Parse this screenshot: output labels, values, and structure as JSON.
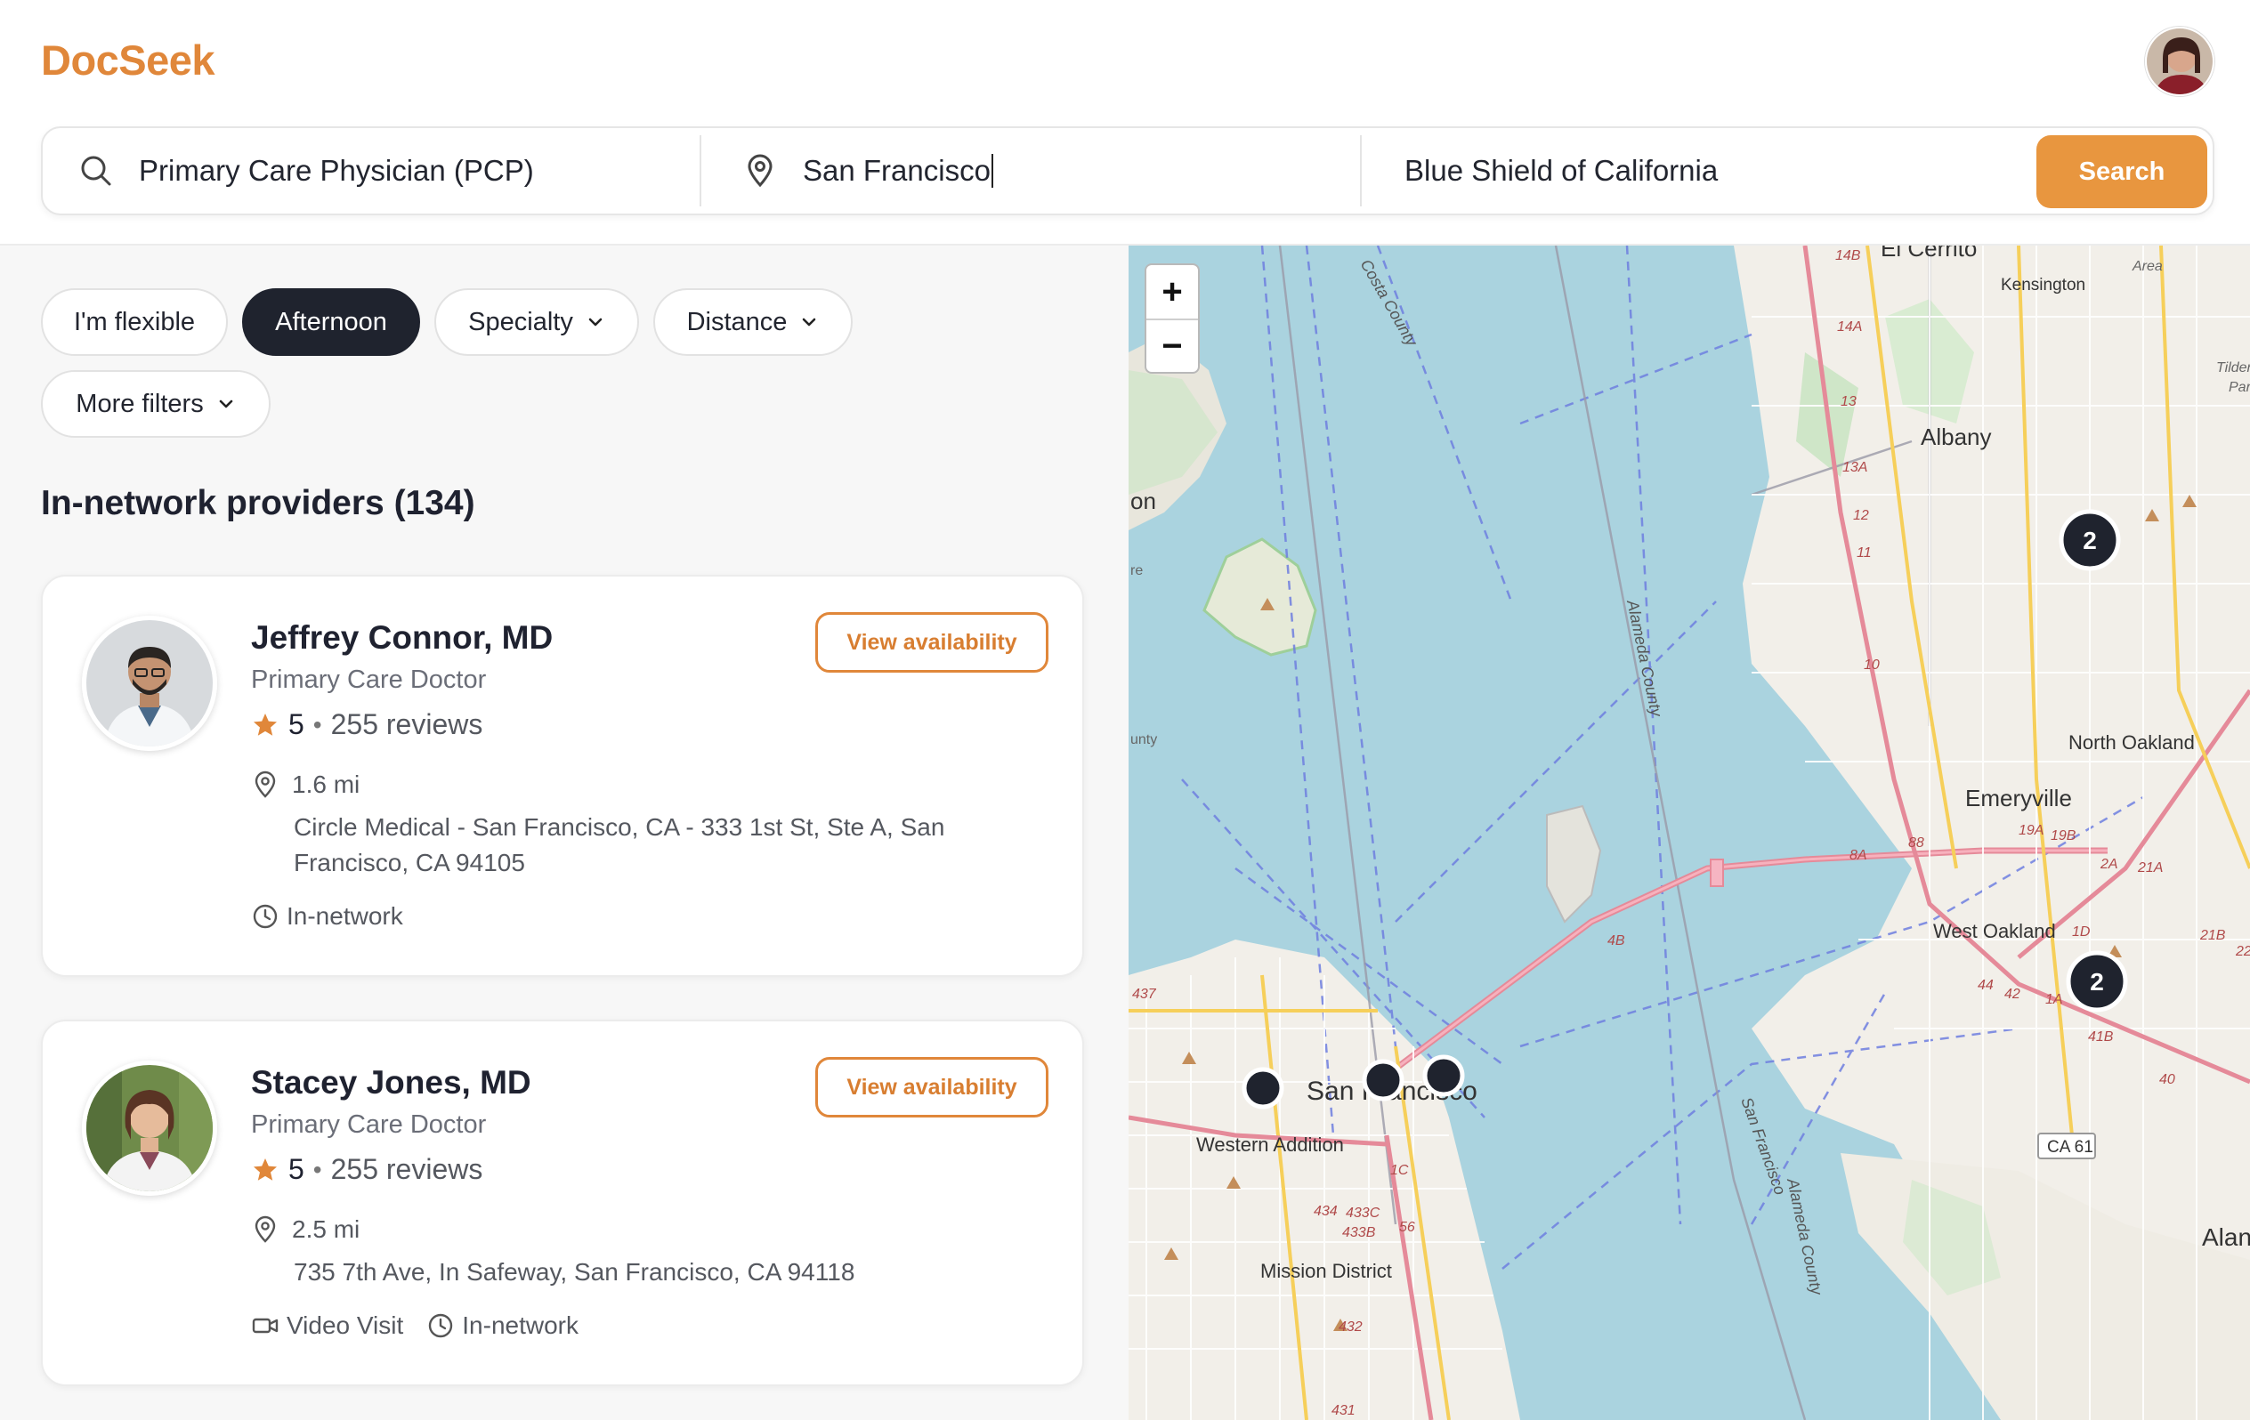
{
  "app": {
    "name": "DocSeek"
  },
  "search": {
    "specialty_value": "Primary Care Physician (PCP)",
    "location_value": "San Francisco",
    "insurance_value": "Blue Shield of California",
    "button_label": "Search"
  },
  "filters": [
    {
      "label": "I'm flexible",
      "selected": false,
      "dropdown": false
    },
    {
      "label": "Afternoon",
      "selected": true,
      "dropdown": false
    },
    {
      "label": "Specialty",
      "selected": false,
      "dropdown": true
    },
    {
      "label": "Distance",
      "selected": false,
      "dropdown": true
    },
    {
      "label": "More filters",
      "selected": false,
      "dropdown": true
    }
  ],
  "results": {
    "title": "In-network providers (134)",
    "providers": [
      {
        "name": "Jeffrey Connor, MD",
        "specialty": "Primary Care Doctor",
        "rating": "5",
        "reviews": "255 reviews",
        "distance": "1.6 mi",
        "address": "Circle Medical - San Francisco, CA - 333 1st St, Ste A, San Francisco, CA 94105",
        "tags": [
          "In-network"
        ],
        "action": "View availability"
      },
      {
        "name": "Stacey Jones, MD",
        "specialty": "Primary Care Doctor",
        "rating": "5",
        "reviews": "255 reviews",
        "distance": "2.5 mi",
        "address": "735 7th Ave, In Safeway, San Francisco, CA 94118",
        "tags": [
          "Video Visit",
          "In-network"
        ],
        "action": "View availability"
      }
    ]
  },
  "map": {
    "zoom_in": "+",
    "zoom_out": "−",
    "cluster_labels": [
      "2",
      "2"
    ],
    "place_labels": [
      "El Cerrito",
      "Kensington",
      "Albany",
      "North Oakland",
      "Emeryville",
      "West Oakland",
      "Western Addition",
      "Mission District",
      "Alameda County",
      "San Francisco",
      "Costa County",
      "CA 61",
      "Alan",
      "on",
      "Area",
      "Tilden Re",
      "Park",
      "unty",
      "re"
    ],
    "road_labels": [
      "14B",
      "14A",
      "13",
      "13A",
      "12",
      "11",
      "10",
      "19A",
      "19B",
      "88",
      "8A",
      "4B",
      "2A",
      "21A",
      "21B",
      "1D",
      "1A",
      "41B",
      "40",
      "42",
      "44",
      "437",
      "434",
      "433C",
      "433B",
      "432",
      "431",
      "56",
      "1C",
      "22"
    ]
  },
  "colors": {
    "brand": "#e0873a",
    "button": "#e8963f",
    "chip_selected": "#1f232e",
    "star": "#e0873a",
    "water": "#aed3df",
    "land": "#f2efe9"
  }
}
